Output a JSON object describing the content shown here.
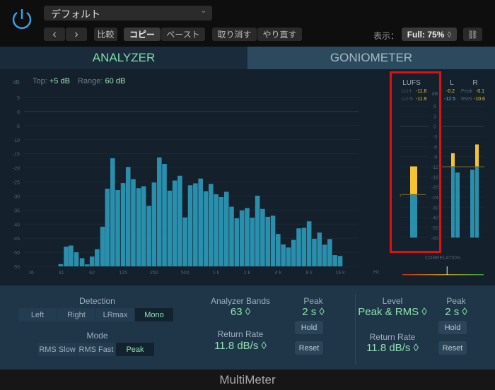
{
  "header": {
    "preset": "デフォルト",
    "compare": "比較",
    "copy": "コピー",
    "paste": "ペースト",
    "undo": "取り消す",
    "redo": "やり直す",
    "view_label": "表示：",
    "view_value": "Full: 75%",
    "prev": "‹",
    "next": "›"
  },
  "tabs": [
    {
      "label": "ANALYZER",
      "active": true
    },
    {
      "label": "GONIOMETER",
      "active": false
    }
  ],
  "analyzer": {
    "db_unit": "dB",
    "top_label": "Top:",
    "top_value": "+5 dB",
    "range_label": "Range:",
    "range_value": "60 dB",
    "hz_unit": "Hz"
  },
  "chart_data": {
    "type": "bar",
    "xlabel": "Hz",
    "ylabel": "dB",
    "x_scale": "log",
    "ylim": [
      -55,
      5
    ],
    "y_ticks": [
      "5",
      "0",
      "-5",
      "-10",
      "-15",
      "-20",
      "-25",
      "-30",
      "-35",
      "-40",
      "-45",
      "-50",
      "-55"
    ],
    "x_ticks": [
      {
        "label": "16",
        "hz": 16
      },
      {
        "label": "31",
        "hz": 31.25
      },
      {
        "label": "62",
        "hz": 62.5
      },
      {
        "label": "125",
        "hz": 125
      },
      {
        "label": "250",
        "hz": 250
      },
      {
        "label": "500",
        "hz": 500
      },
      {
        "label": "1 k",
        "hz": 1000
      },
      {
        "label": "2 k",
        "hz": 2000
      },
      {
        "label": "4 k",
        "hz": 4000
      },
      {
        "label": "8 k",
        "hz": 8000
      },
      {
        "label": "16 k",
        "hz": 16000
      }
    ],
    "frequencies_hz": [
      31,
      35,
      39,
      44,
      50,
      56,
      62.5,
      70,
      79,
      88,
      99,
      111,
      125,
      140,
      157,
      177,
      198,
      223,
      250,
      281,
      315,
      354,
      397,
      445,
      500,
      561,
      630,
      707,
      794,
      891,
      1000,
      1122,
      1260,
      1414,
      1587,
      1782,
      2000,
      2245,
      2520,
      2828,
      3175,
      3564,
      4000,
      4490,
      5040,
      5657,
      6350,
      7127,
      8000,
      8980,
      10079,
      11314,
      12699,
      14254,
      16000
    ],
    "values": [
      -54.2,
      -48,
      -47.6,
      -50,
      -52.1,
      -54.3,
      -51.5,
      -48.9,
      -40.9,
      -27.4,
      -16.6,
      -27.9,
      -25.4,
      -19.7,
      -24,
      -27.2,
      -26.5,
      -33.5,
      -25.2,
      -16.3,
      -18.6,
      -28.1,
      -24.5,
      -22.8,
      -37.6,
      -26.2,
      -25.5,
      -23.8,
      -28.3,
      -25.7,
      -29.4,
      -30.4,
      -28.5,
      -33.8,
      -37.9,
      -35.1,
      -34.3,
      -37.7,
      -29.9,
      -34.6,
      -37.4,
      -37,
      -43.5,
      -47.2,
      -48.3,
      -45.6,
      -41.5,
      -41.3,
      -39,
      -45.2,
      -43,
      -47.3,
      -45.3,
      -51,
      -51.3
    ],
    "color": "#2a8fad"
  },
  "meters": {
    "lufs_title": "LUFS",
    "lu_i_label": "LU-I",
    "lu_i": "-11.6",
    "lu_s_label": "LU-S",
    "lu_s": "-11.9",
    "db_unit": "dB",
    "l_title": "L",
    "r_title": "R",
    "peak_label": "Peak",
    "rms_label": "RMS",
    "l_peak": "-0.2",
    "r_peak": "-0.1",
    "l_rms": "-12.5",
    "r_rms": "-10.6",
    "scale": [
      "6",
      "3",
      "0",
      "-3",
      "-6",
      "-9",
      "-12",
      "-16",
      "-20",
      "-24",
      "-30",
      "-40",
      "-50",
      "-60"
    ],
    "lufs_level": -11.9,
    "lufs_target": -23,
    "l_peak_bar": -8,
    "l_rms_bar": -14.3,
    "r_rms_bar": -13.2,
    "r_peak_bar": -5.4,
    "threshold": -12,
    "correlation_label": "CORRELATION",
    "correlation": 0.1,
    "colors": {
      "blue": "#2a8fad",
      "yellow": "#f4c234",
      "highlight": "#e01010"
    }
  },
  "controls": {
    "detection_label": "Detection",
    "detection": [
      "Left",
      "Right",
      "LRmax",
      "Mono"
    ],
    "detection_selected": "Mono",
    "mode_label": "Mode",
    "mode": [
      "RMS Slow",
      "RMS Fast",
      "Peak"
    ],
    "mode_selected": "Peak",
    "bands_label": "Analyzer Bands",
    "bands_value": "63 ◊",
    "return_label": "Return Rate",
    "return_value": "11.8 dB/s ◊",
    "peak_label": "Peak",
    "peak_value": "2 s ◊",
    "hold": "Hold",
    "reset": "Reset",
    "level_label": "Level",
    "level_value": "Peak & RMS ◊",
    "return2_label": "Return Rate",
    "return2_value": "11.8 dB/s ◊",
    "peak2_label": "Peak",
    "peak2_value": "2 s ◊",
    "hold2": "Hold",
    "reset2": "Reset"
  },
  "footer": {
    "title": "MultiMeter"
  }
}
